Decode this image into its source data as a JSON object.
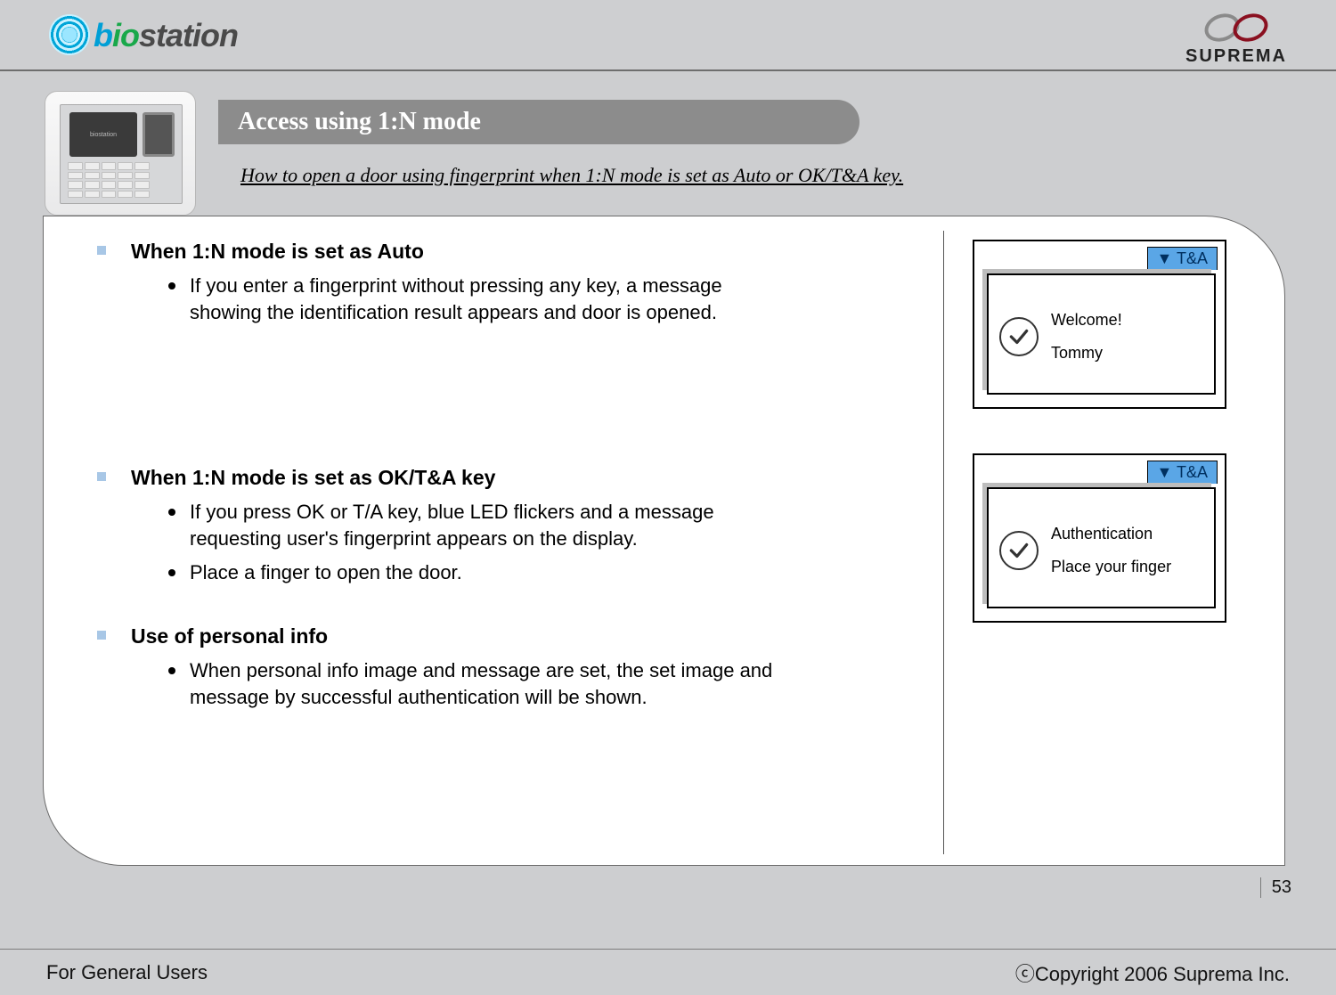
{
  "brand_left": {
    "b": "b",
    "io": "io",
    "rest": "station"
  },
  "brand_right": "SUPREMA",
  "title": "Access using 1:N mode",
  "subtitle": "How to open a door using fingerprint when 1:N mode is set as Auto or OK/T&A key.",
  "sections": [
    {
      "heading": "When 1:N mode is set as Auto",
      "items": [
        "If you enter a fingerprint without pressing any key, a message showing the identification result appears and door is opened."
      ]
    },
    {
      "heading": "When 1:N mode is set as OK/T&A key",
      "items": [
        "If you press OK or T/A key, blue LED flickers and a message requesting user's fingerprint appears on the display.",
        "Place a finger to open the door."
      ]
    },
    {
      "heading": "Use of personal info",
      "items": [
        "When personal info image and message are set, the set image and message by successful authentication will be shown."
      ]
    }
  ],
  "displays": [
    {
      "tab": "▼ T&A",
      "line1": "Welcome!",
      "line2": "Tommy"
    },
    {
      "tab": "▼ T&A",
      "line1": "Authentication",
      "line2": "Place your finger"
    }
  ],
  "page_number": "53",
  "footer_left": "For General Users",
  "footer_right": "ⓒCopyright 2006 Suprema Inc."
}
